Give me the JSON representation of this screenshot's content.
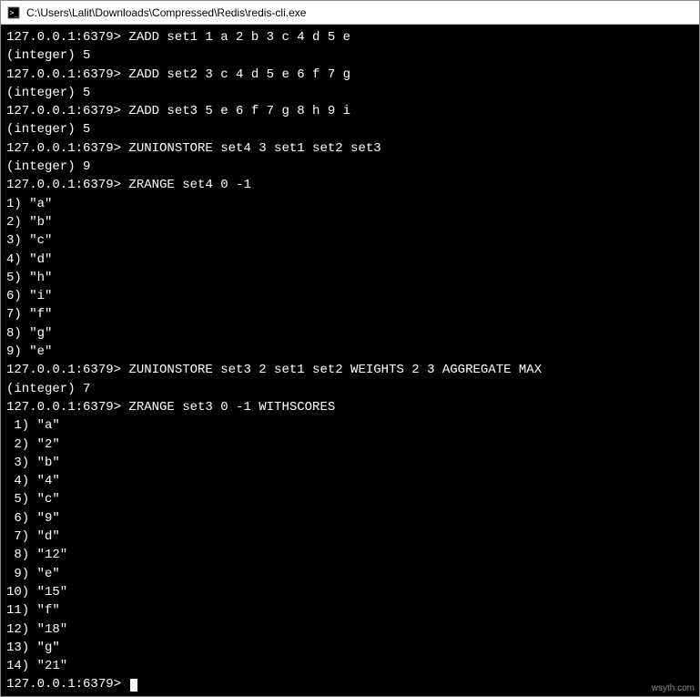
{
  "window": {
    "title": "C:\\Users\\Lalit\\Downloads\\Compressed\\Redis\\redis-cli.exe"
  },
  "terminal": {
    "prompt": "127.0.0.1:6379>",
    "lines": [
      {
        "type": "cmd",
        "text": "ZADD set1 1 a 2 b 3 c 4 d 5 e"
      },
      {
        "type": "out",
        "text": "(integer) 5"
      },
      {
        "type": "cmd",
        "text": "ZADD set2 3 c 4 d 5 e 6 f 7 g"
      },
      {
        "type": "out",
        "text": "(integer) 5"
      },
      {
        "type": "cmd",
        "text": "ZADD set3 5 e 6 f 7 g 8 h 9 i"
      },
      {
        "type": "out",
        "text": "(integer) 5"
      },
      {
        "type": "cmd",
        "text": "ZUNIONSTORE set4 3 set1 set2 set3"
      },
      {
        "type": "out",
        "text": "(integer) 9"
      },
      {
        "type": "cmd",
        "text": "ZRANGE set4 0 -1"
      },
      {
        "type": "out",
        "text": "1) \"a\""
      },
      {
        "type": "out",
        "text": "2) \"b\""
      },
      {
        "type": "out",
        "text": "3) \"c\""
      },
      {
        "type": "out",
        "text": "4) \"d\""
      },
      {
        "type": "out",
        "text": "5) \"h\""
      },
      {
        "type": "out",
        "text": "6) \"i\""
      },
      {
        "type": "out",
        "text": "7) \"f\""
      },
      {
        "type": "out",
        "text": "8) \"g\""
      },
      {
        "type": "out",
        "text": "9) \"e\""
      },
      {
        "type": "cmd",
        "text": "ZUNIONSTORE set3 2 set1 set2 WEIGHTS 2 3 AGGREGATE MAX"
      },
      {
        "type": "out",
        "text": "(integer) 7"
      },
      {
        "type": "cmd",
        "text": "ZRANGE set3 0 -1 WITHSCORES"
      },
      {
        "type": "out",
        "text": " 1) \"a\""
      },
      {
        "type": "out",
        "text": " 2) \"2\""
      },
      {
        "type": "out",
        "text": " 3) \"b\""
      },
      {
        "type": "out",
        "text": " 4) \"4\""
      },
      {
        "type": "out",
        "text": " 5) \"c\""
      },
      {
        "type": "out",
        "text": " 6) \"9\""
      },
      {
        "type": "out",
        "text": " 7) \"d\""
      },
      {
        "type": "out",
        "text": " 8) \"12\""
      },
      {
        "type": "out",
        "text": " 9) \"e\""
      },
      {
        "type": "out",
        "text": "10) \"15\""
      },
      {
        "type": "out",
        "text": "11) \"f\""
      },
      {
        "type": "out",
        "text": "12) \"18\""
      },
      {
        "type": "out",
        "text": "13) \"g\""
      },
      {
        "type": "out",
        "text": "14) \"21\""
      },
      {
        "type": "cmd",
        "text": "",
        "cursor": true
      }
    ]
  },
  "watermark": "wsyth.com"
}
